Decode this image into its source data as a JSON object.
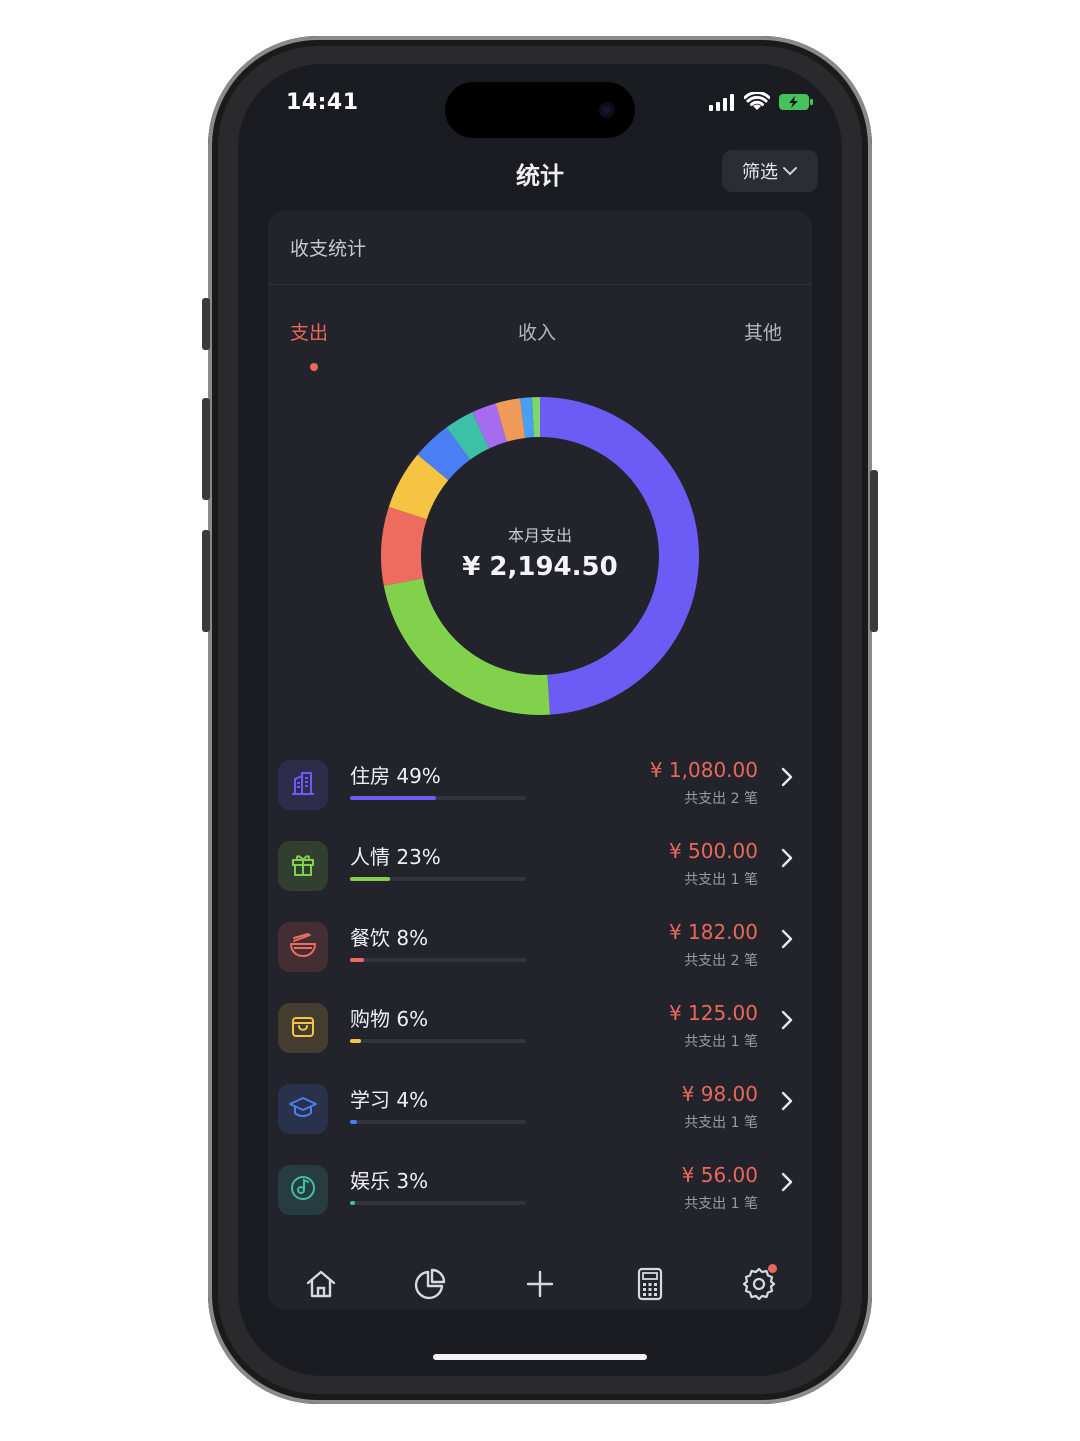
{
  "status": {
    "time": "14:41"
  },
  "header": {
    "title": "统计",
    "filter_label": "筛选"
  },
  "card": {
    "title": "收支统计"
  },
  "tabs": [
    {
      "label": "支出",
      "active": true
    },
    {
      "label": "收入",
      "active": false
    },
    {
      "label": "其他",
      "active": false
    }
  ],
  "summary": {
    "label": "本月支出",
    "amount": "¥ 2,194.50"
  },
  "categories": [
    {
      "name": "住房 49%",
      "amount": "¥ 1,080.00",
      "count": "共支出 2 笔",
      "icon": "building-icon",
      "color": "#6c5cf5",
      "share": 49
    },
    {
      "name": "人情 23%",
      "amount": "¥ 500.00",
      "count": "共支出 1 笔",
      "icon": "gift-icon",
      "color": "#82d14c",
      "share": 23
    },
    {
      "name": "餐饮 8%",
      "amount": "¥ 182.00",
      "count": "共支出 2 笔",
      "icon": "bowl-icon",
      "color": "#ee6b60",
      "share": 8
    },
    {
      "name": "购物 6%",
      "amount": "¥ 125.00",
      "count": "共支出 1 笔",
      "icon": "bag-icon",
      "color": "#f5c443",
      "share": 6
    },
    {
      "name": "学习 4%",
      "amount": "¥ 98.00",
      "count": "共支出 1 笔",
      "icon": "graduation-cap-icon",
      "color": "#4a7ef5",
      "share": 4
    },
    {
      "name": "娱乐 3%",
      "amount": "¥ 56.00",
      "count": "共支出 1 笔",
      "icon": "music-disc-icon",
      "color": "#3ebfa8",
      "share": 3
    }
  ],
  "chart_data": {
    "type": "pie",
    "title": "",
    "slices": [
      {
        "value": 49,
        "color": "#6c5cf5"
      },
      {
        "value": 23,
        "color": "#82d14c"
      },
      {
        "value": 8,
        "color": "#ee6b60"
      },
      {
        "value": 6,
        "color": "#f5c443"
      },
      {
        "value": 4,
        "color": "#4a7ef5"
      },
      {
        "value": 3,
        "color": "#3ebfa8"
      },
      {
        "value": 2.5,
        "color": "#a56cf0"
      },
      {
        "value": 2.5,
        "color": "#f09a5a"
      },
      {
        "value": 1.2,
        "color": "#4aa0f0"
      },
      {
        "value": 0.8,
        "color": "#7fd66a"
      }
    ]
  },
  "tabbar": [
    {
      "icon": "home-icon"
    },
    {
      "icon": "pie-chart-icon"
    },
    {
      "icon": "plus-icon"
    },
    {
      "icon": "calculator-icon"
    },
    {
      "icon": "settings-icon",
      "badge": true
    }
  ]
}
